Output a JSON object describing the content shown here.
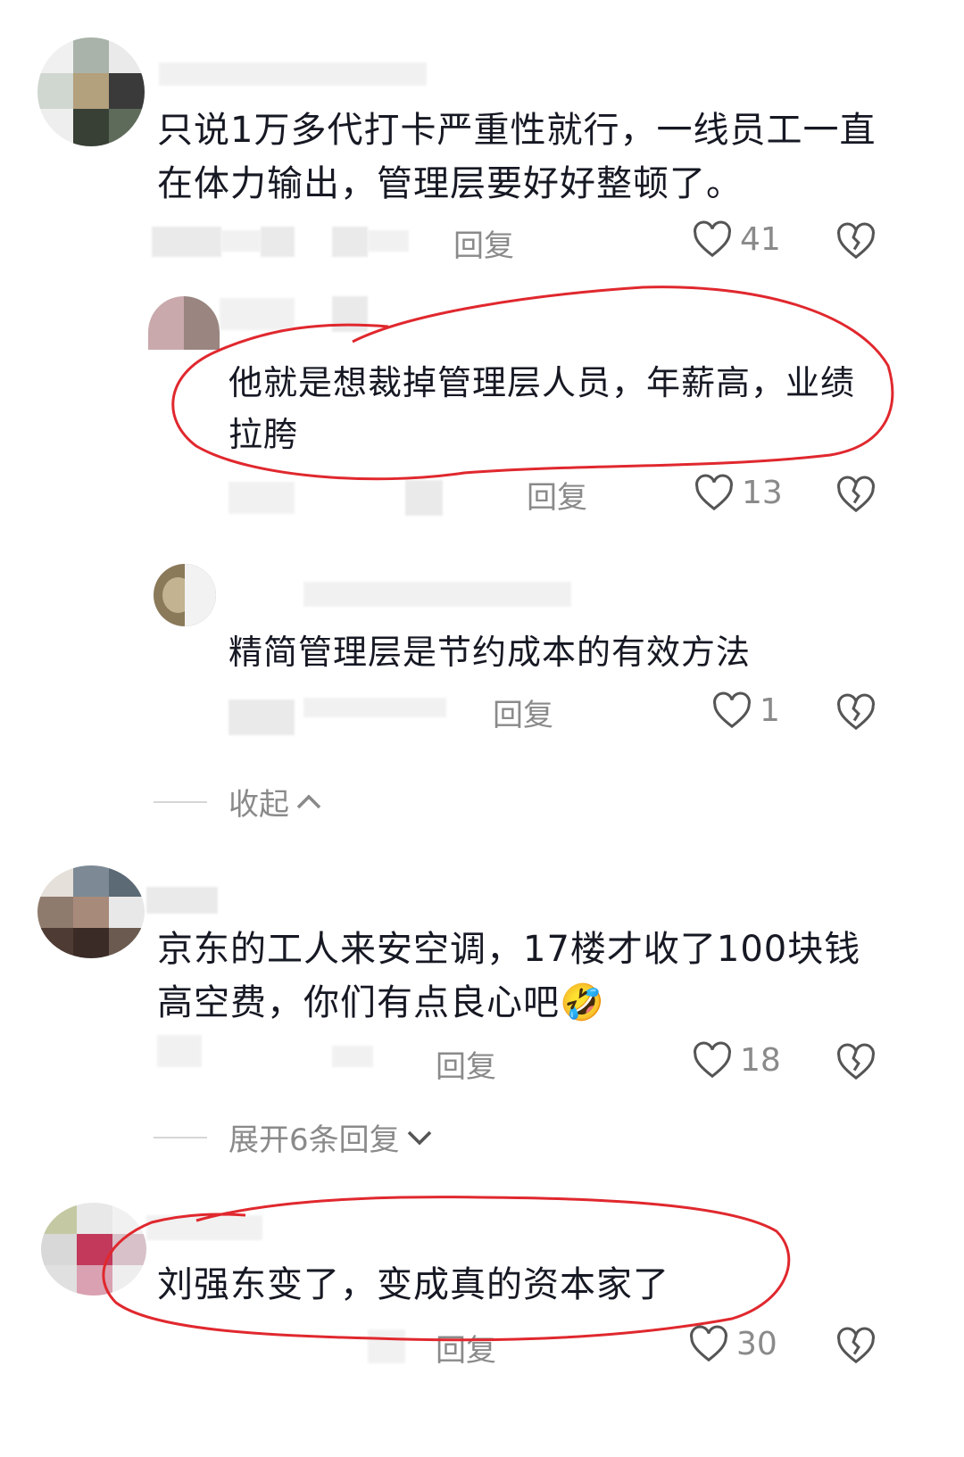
{
  "comments": [
    {
      "text": "只说1万多代打卡严重性就行，一线员工一直在体力输出，管理层要好好整顿了。",
      "reply_label": "回复",
      "likes": "41"
    },
    {
      "text": "他就是想裁掉管理层人员，年薪高，业绩拉胯",
      "reply_label": "回复",
      "likes": "13"
    },
    {
      "text": "精简管理层是节约成本的有效方法",
      "reply_label": "回复",
      "likes": "1"
    },
    {
      "text": "京东的工人来安空调，17楼才收了100块钱高空费，你们有点良心吧",
      "reply_label": "回复",
      "likes": "18"
    },
    {
      "text": "刘强东变了，变成真的资本家了",
      "reply_label": "回复",
      "likes": "30"
    }
  ],
  "collapse_label": "收起",
  "expand_label": "展开6条回复",
  "emoji": "🤣",
  "colors": {
    "text": "#161823",
    "meta": "#8a8a8a",
    "annotation_red": "#e0282e"
  },
  "icons": [
    "heart-outline-icon",
    "broken-heart-icon",
    "chevron-up-icon",
    "chevron-down-icon"
  ]
}
